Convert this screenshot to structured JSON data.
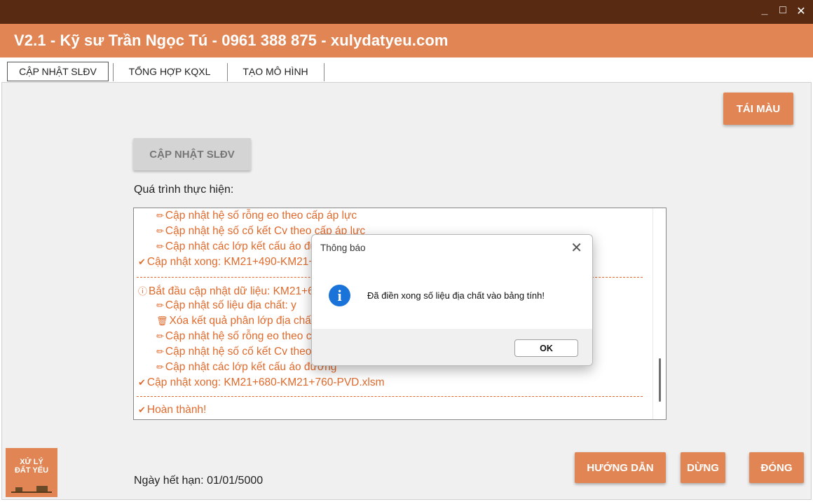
{
  "window": {
    "title": "V2.1 - Kỹ sư Trần Ngọc Tú - 0961 388 875 - xulydatyeu.com",
    "controls": {
      "minimize": "_",
      "maximize": "□",
      "close": "✕"
    }
  },
  "tabs": [
    {
      "label": "CẬP NHẬT SLĐV",
      "active": true
    },
    {
      "label": "TỔNG HỢP KQXL",
      "active": false
    },
    {
      "label": "TẠO MÔ HÌNH",
      "active": false
    }
  ],
  "main": {
    "recolor_button": "TÁI MÀU",
    "update_button": "CẬP NHẬT SLĐV",
    "progress_label": "Quá trình thực hiện:",
    "log": [
      {
        "text": "Cập nhật hệ số rỗng eo theo cấp áp lực",
        "icon": "✏",
        "indent": true
      },
      {
        "text": "Cập nhật hệ số cố kết Cv theo cấp áp lực",
        "icon": "✏",
        "indent": true
      },
      {
        "text": "Cập nhật các lớp kết cấu áo đường",
        "icon": "✏",
        "indent": true
      },
      {
        "text": "Cập nhật xong: KM21+490-KM21+680-PVD.xlsm",
        "icon": "✔",
        "indent": false
      },
      {
        "text": "Bắt đầu cập nhật dữ liệu: KM21+680-KM21+760-PVD.xlsm",
        "icon": "ⓘ",
        "indent": false
      },
      {
        "text": "Cập nhật số liệu địa chất: y",
        "icon": "✏",
        "indent": true
      },
      {
        "text": "Xóa kết quả phân lớp địa chất",
        "icon": "🗑",
        "indent": true
      },
      {
        "text": "Cập nhật hệ số rỗng eo theo cấp áp lực",
        "icon": "✏",
        "indent": true
      },
      {
        "text": "Cập nhật hệ số cố kết Cv theo cấp áp lực",
        "icon": "✏",
        "indent": true
      },
      {
        "text": "Cập nhật các lớp kết cấu áo đường",
        "icon": "✏",
        "indent": true
      },
      {
        "text": "Cập nhật xong: KM21+680-KM21+760-PVD.xlsm",
        "icon": "✔",
        "indent": false
      },
      {
        "text": "Hoàn thành!",
        "icon": "✔",
        "indent": false
      }
    ],
    "logo_line1": "XỬ LÝ",
    "logo_line2": "ĐẤT YẾU",
    "expiry": "Ngày hết hạn: 01/01/5000",
    "guide_button": "HƯỚNG DẪN",
    "stop_button": "DỪNG",
    "close_button": "ĐÓNG"
  },
  "dialog": {
    "title": "Thông báo",
    "close": "✕",
    "icon": "i",
    "message": "Đã điền xong số liệu địa chất vào bảng tính!",
    "ok": "OK"
  },
  "colors": {
    "titlebar": "#582a12",
    "accent": "#e08553",
    "log_text": "#e06a2c",
    "info_icon": "#1a73d9"
  }
}
